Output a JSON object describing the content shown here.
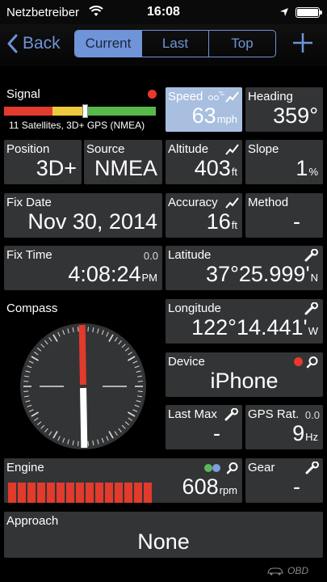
{
  "status_bar": {
    "carrier": "Netzbetreiber",
    "time": "16:08"
  },
  "nav": {
    "back_label": "Back",
    "tabs": [
      {
        "label": "Current",
        "selected": true
      },
      {
        "label": "Last",
        "selected": false
      },
      {
        "label": "Top",
        "selected": false
      }
    ],
    "add_icon": "plus-icon"
  },
  "tiles": {
    "signal": {
      "label": "Signal",
      "status_text": "11 Satellites, 3D+ GPS (NMEA)",
      "level_fraction": 0.53
    },
    "speed": {
      "label": "Speed",
      "value": "63",
      "unit": "mph"
    },
    "heading": {
      "label": "Heading",
      "value": "359°"
    },
    "position": {
      "label": "Position",
      "value": "3D+"
    },
    "source": {
      "label": "Source",
      "value": "NMEA"
    },
    "altitude": {
      "label": "Altitude",
      "value": "403",
      "unit": "ft"
    },
    "slope": {
      "label": "Slope",
      "value": "1",
      "unit": "%"
    },
    "fix_date": {
      "label": "Fix Date",
      "value": "Nov 30, 2014"
    },
    "accuracy": {
      "label": "Accuracy",
      "value": "16",
      "unit": "ft"
    },
    "method": {
      "label": "Method",
      "value": "-"
    },
    "fix_time": {
      "label": "Fix Time",
      "tag": "0.0",
      "value": "4:08:24",
      "unit": "PM"
    },
    "latitude": {
      "label": "Latitude",
      "value": "37°25.999'",
      "unit": "N"
    },
    "compass": {
      "label": "Compass",
      "heading_deg": 359
    },
    "longitude": {
      "label": "Longitude",
      "value": "122°14.441'",
      "unit": "W"
    },
    "device": {
      "label": "Device",
      "value": "iPhone"
    },
    "last_max": {
      "label": "Last Max",
      "value": "-"
    },
    "gps_rate": {
      "label": "GPS Rat.",
      "tag": "0.0",
      "value": "9",
      "unit": "Hz"
    },
    "engine": {
      "label": "Engine",
      "value": "608",
      "unit": "rpm",
      "bar_count": 15
    },
    "gear": {
      "label": "Gear",
      "value": "-"
    },
    "approach": {
      "label": "Approach",
      "value": "None"
    }
  },
  "footer": {
    "brand": "OBD"
  },
  "colors": {
    "accent": "#6f94d8",
    "tile": "#333436",
    "highlight": "#a8bfdf",
    "red": "#e23a2c",
    "yellow": "#ecc93d",
    "green": "#58b84a"
  }
}
